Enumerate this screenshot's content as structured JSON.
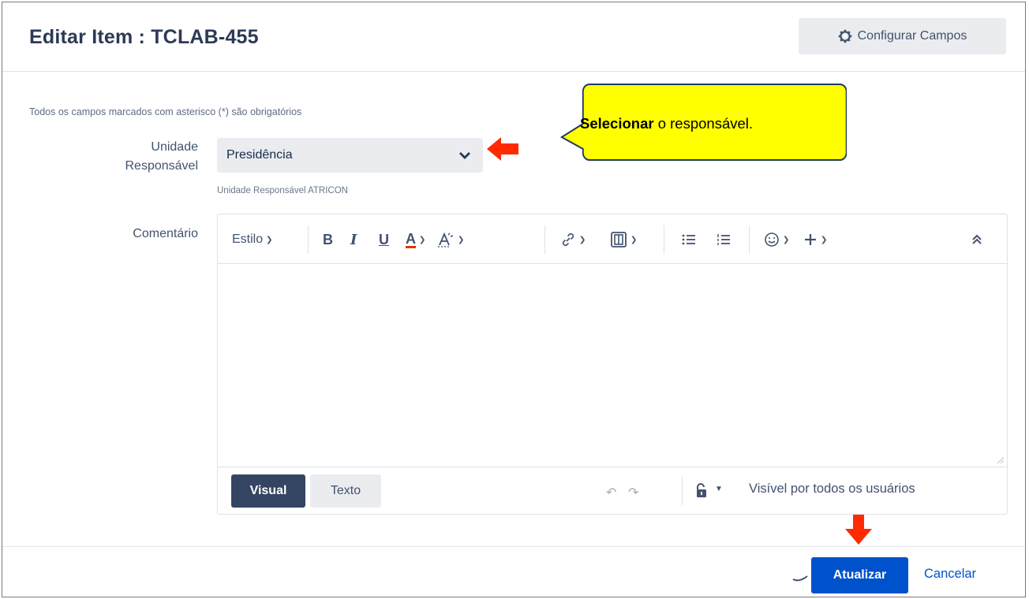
{
  "dialog": {
    "title": "Editar Item : TCLAB-455",
    "config_button": "Configurar Campos"
  },
  "form": {
    "required_note": "Todos os campos marcados com asterisco (*) são obrigatórios",
    "unidade_label": "Unidade Responsável",
    "unidade_value": "Presidência",
    "unidade_help": "Unidade Responsável ATRICON",
    "comentario_label": "Comentário"
  },
  "editor": {
    "style_label": "Estilo",
    "bold": "B",
    "italic": "I",
    "underline": "U",
    "text_color": "A",
    "mode_visual": "Visual",
    "mode_texto": "Texto",
    "visibility": "Visível por todos os usuários"
  },
  "actions": {
    "submit": "Atualizar",
    "cancel": "Cancelar"
  },
  "callout": {
    "bold_part": "Selecionar",
    "rest": " o responsável."
  },
  "colors": {
    "primary": "#0052cc",
    "callout_fill": "#ffff00",
    "arrow": "#ff2a00",
    "dark_button": "#344563"
  },
  "icons": [
    "gear-icon",
    "chevron-down-icon",
    "link-icon",
    "image-icon",
    "bullet-list-icon",
    "numbered-list-icon",
    "emoji-icon",
    "plus-icon",
    "collapse-icon",
    "undo-icon",
    "redo-icon",
    "lock-icon",
    "arrow-annotation"
  ]
}
